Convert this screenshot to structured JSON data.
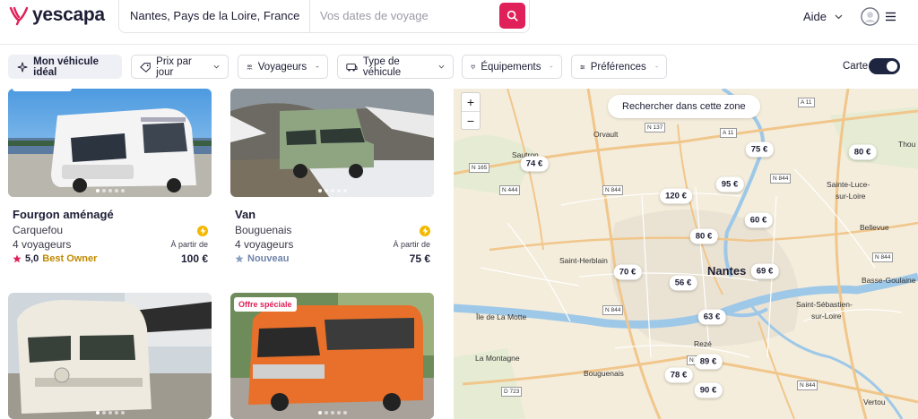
{
  "brand": {
    "name": "yescapa",
    "color": "#e02058"
  },
  "search": {
    "location": "Nantes, Pays de la Loire, France",
    "dates_placeholder": "Vos dates de voyage"
  },
  "header": {
    "help_label": "Aide"
  },
  "filters": {
    "ideal_vehicle": "Mon véhicule idéal",
    "items": [
      "Prix par jour",
      "Voyageurs",
      "Type de véhicule",
      "Équipements",
      "Préférences"
    ],
    "map_toggle_label": "Carte",
    "map_toggle_on": true
  },
  "listings": [
    {
      "title": "Fourgon aménagé",
      "location": "Carquefou",
      "travelers": "4 voyageurs",
      "from_label": "À partir de",
      "price": "100 €",
      "rating": "5,0",
      "owner_badge": "Best Owner"
    },
    {
      "title": "Van",
      "location": "Bouguenais",
      "travelers": "4 voyageurs",
      "from_label": "À partir de",
      "price": "75 €",
      "status": "Nouveau"
    },
    {
      "badge": ""
    },
    {
      "badge": "Offre spéciale"
    }
  ],
  "map": {
    "search_area_label": "Rechercher dans cette zone",
    "zoom_in": "+",
    "zoom_out": "−",
    "prices": [
      "74 €",
      "75 €",
      "80 €",
      "95 €",
      "120 €",
      "60 €",
      "80 €",
      "70 €",
      "56 €",
      "69 €",
      "63 €",
      "89 €",
      "78 €",
      "90 €"
    ],
    "places": [
      "Orvault",
      "Sautron",
      "Thou",
      "Sainte-Luce-",
      "sur-Loire",
      "Bellevue",
      "Saint-Herblain",
      "Nantes",
      "Basse-Goulaine",
      "Saint-Sébastien-",
      "sur-Loire",
      "Île de La Motte",
      "Rezé",
      "La Montagne",
      "Bouguenais",
      "Vertou"
    ],
    "roads": [
      "N 137",
      "A 11",
      "A 11",
      "N 165",
      "N 444",
      "N 844",
      "N 844",
      "N 844",
      "N 844",
      "N 844",
      "N 844",
      "D 723",
      "N 444",
      "N 844"
    ]
  }
}
